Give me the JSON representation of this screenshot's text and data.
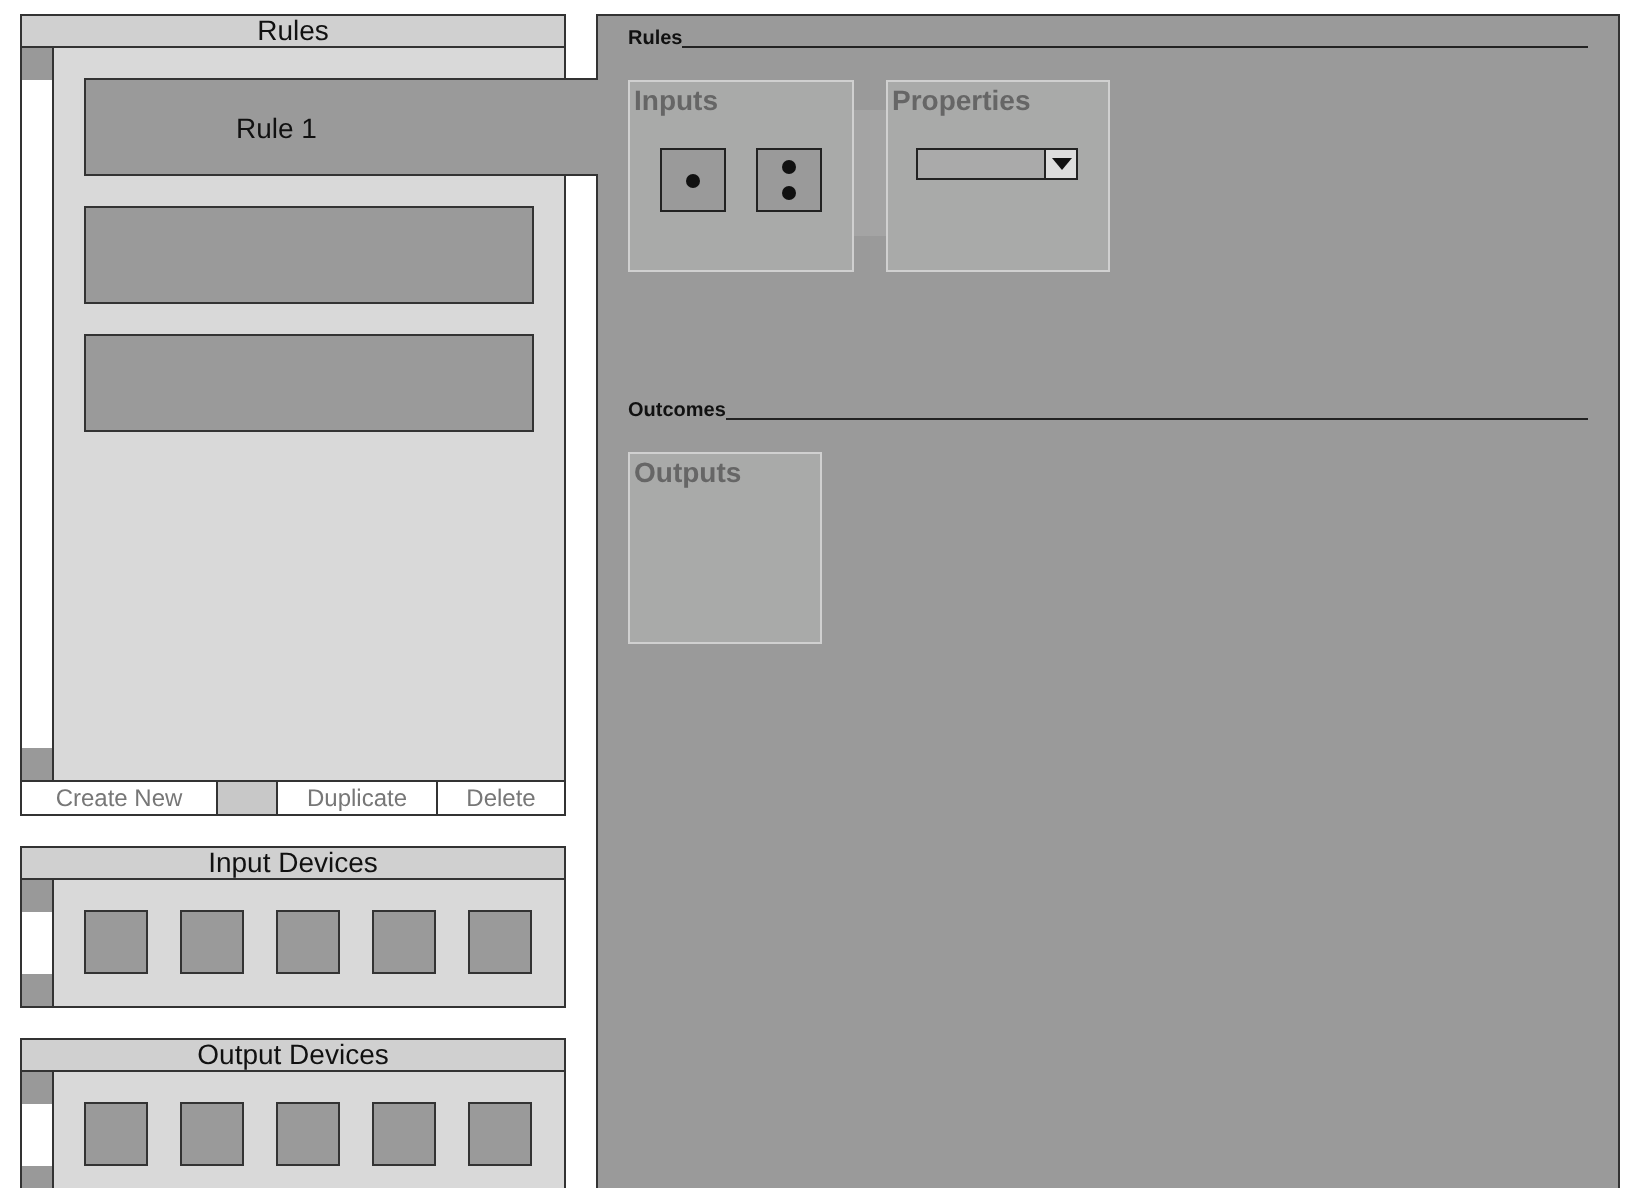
{
  "rules_panel": {
    "title": "Rules",
    "rules": [
      {
        "label": "Rule 1",
        "selected": true
      },
      {
        "selected": false
      },
      {
        "selected": false
      }
    ],
    "buttons": [
      {
        "kind": "text",
        "label": "Create New"
      },
      {
        "kind": "blank"
      },
      {
        "kind": "text",
        "label": "Duplicate"
      },
      {
        "kind": "text",
        "label": "Delete"
      }
    ]
  },
  "device_panels": [
    {
      "title": "Input Devices",
      "slots": [
        {
          "kind": "empty"
        },
        {
          "kind": "empty"
        },
        {
          "kind": "empty"
        },
        {
          "kind": "empty"
        },
        {
          "kind": "empty"
        }
      ]
    },
    {
      "title": "Output Devices",
      "slots": [
        {
          "kind": "empty"
        },
        {
          "kind": "empty"
        },
        {
          "kind": "empty"
        },
        {
          "kind": "empty"
        },
        {
          "kind": "empty"
        }
      ]
    }
  ],
  "editor": {
    "sections": [
      {
        "heading": "Rules",
        "groups": [
          {
            "kind": "inputs",
            "title": "Inputs",
            "slots": [
              {
                "kind": "one-dot"
              },
              {
                "kind": "two-dot"
              }
            ]
          },
          {
            "kind": "properties",
            "title": "Properties"
          }
        ]
      },
      {
        "heading": "Outcomes",
        "groups": [
          {
            "kind": "outputs",
            "title": "Outputs"
          }
        ]
      }
    ]
  }
}
